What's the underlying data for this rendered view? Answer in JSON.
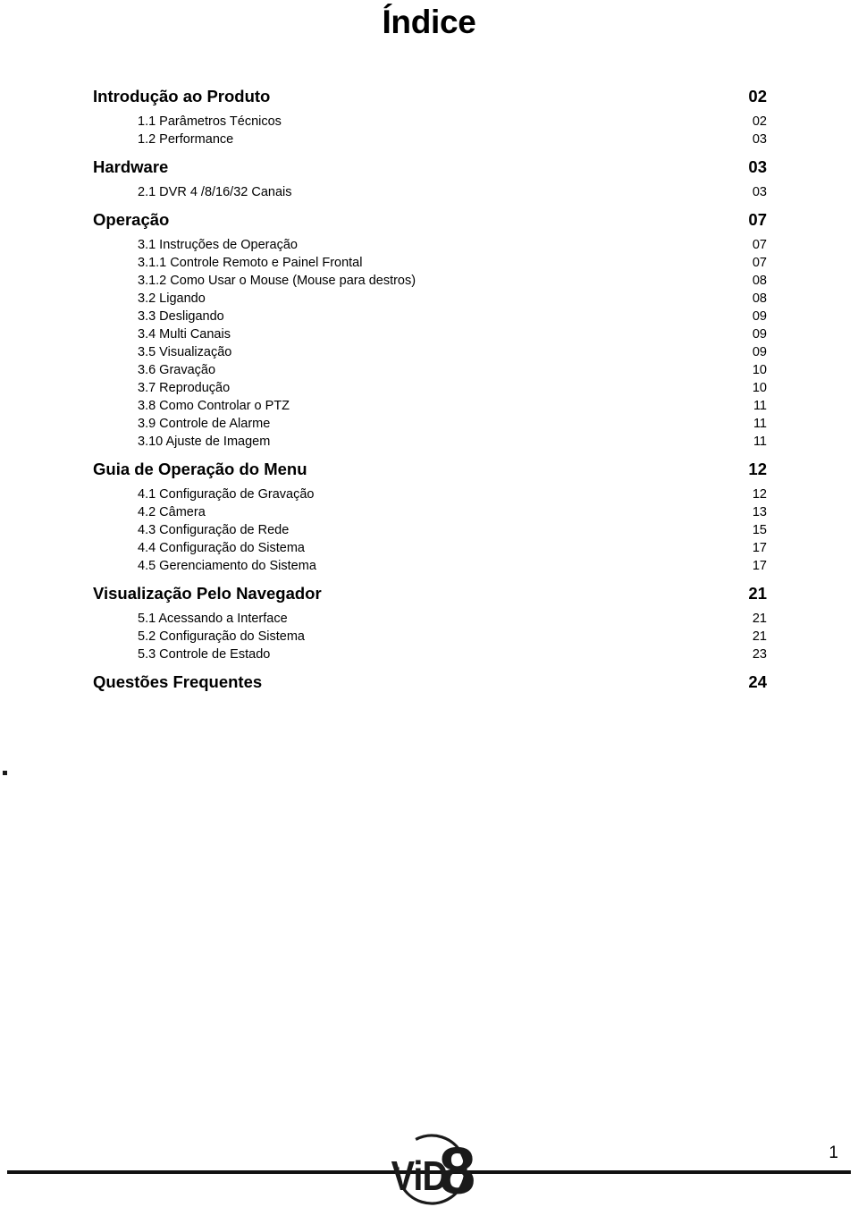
{
  "document": {
    "title": "Índice",
    "page_number": "1",
    "stray_mark": "."
  },
  "toc": {
    "entries": [
      {
        "level": 1,
        "label": "Introdução ao Produto",
        "page": "02"
      },
      {
        "level": 2,
        "label": "1.1 Parâmetros Técnicos",
        "page": "02"
      },
      {
        "level": 2,
        "label": "1.2 Performance",
        "page": "03"
      },
      {
        "level": 1,
        "label": "Hardware",
        "page": "03"
      },
      {
        "level": 2,
        "label": "2.1 DVR 4 /8/16/32 Canais",
        "page": "03"
      },
      {
        "level": 1,
        "label": "Operação",
        "page": "07"
      },
      {
        "level": 2,
        "label": "3.1 Instruções de Operação",
        "page": "07"
      },
      {
        "level": 2,
        "label": "3.1.1 Controle Remoto e Painel Frontal",
        "page": "07"
      },
      {
        "level": 2,
        "label": "3.1.2 Como Usar o Mouse (Mouse para destros)",
        "page": "08"
      },
      {
        "level": 2,
        "label": "3.2 Ligando",
        "page": "08"
      },
      {
        "level": 2,
        "label": "3.3 Desligando",
        "page": "09"
      },
      {
        "level": 2,
        "label": "3.4 Multi Canais",
        "page": "09"
      },
      {
        "level": 2,
        "label": "3.5 Visualização",
        "page": "09"
      },
      {
        "level": 2,
        "label": "3.6 Gravação",
        "page": "10"
      },
      {
        "level": 2,
        "label": "3.7 Reprodução",
        "page": "10"
      },
      {
        "level": 2,
        "label": "3.8 Como Controlar o PTZ",
        "page": "11"
      },
      {
        "level": 2,
        "label": "3.9 Controle de Alarme",
        "page": "11"
      },
      {
        "level": 2,
        "label": "3.10 Ajuste de Imagem",
        "page": "11"
      },
      {
        "level": 1,
        "label": "Guia de Operação do Menu",
        "page": "12"
      },
      {
        "level": 2,
        "label": "4.1 Configuração de Gravação",
        "page": "12"
      },
      {
        "level": 2,
        "label": "4.2 Câmera",
        "page": "13"
      },
      {
        "level": 2,
        "label": "4.3 Configuração de Rede",
        "page": "15"
      },
      {
        "level": 2,
        "label": "4.4 Configuração do Sistema",
        "page": "17"
      },
      {
        "level": 2,
        "label": "4.5 Gerenciamento do Sistema",
        "page": "17"
      },
      {
        "level": 1,
        "label": "Visualização Pelo Navegador",
        "page": "21"
      },
      {
        "level": 2,
        "label": "5.1 Acessando a Interface",
        "page": "21"
      },
      {
        "level": 2,
        "label": "5.2 Configuração do Sistema",
        "page": "21"
      },
      {
        "level": 2,
        "label": "5.3 Controle de Estado",
        "page": "23"
      },
      {
        "level": 1,
        "label": "Questões Frequentes",
        "page": "24"
      }
    ]
  },
  "footer": {
    "logo_text_primary": "ViD",
    "logo_text_secondary": "8",
    "page_number": "1"
  },
  "colors": {
    "text": "#000000",
    "rule": "#111111",
    "background": "#ffffff"
  }
}
